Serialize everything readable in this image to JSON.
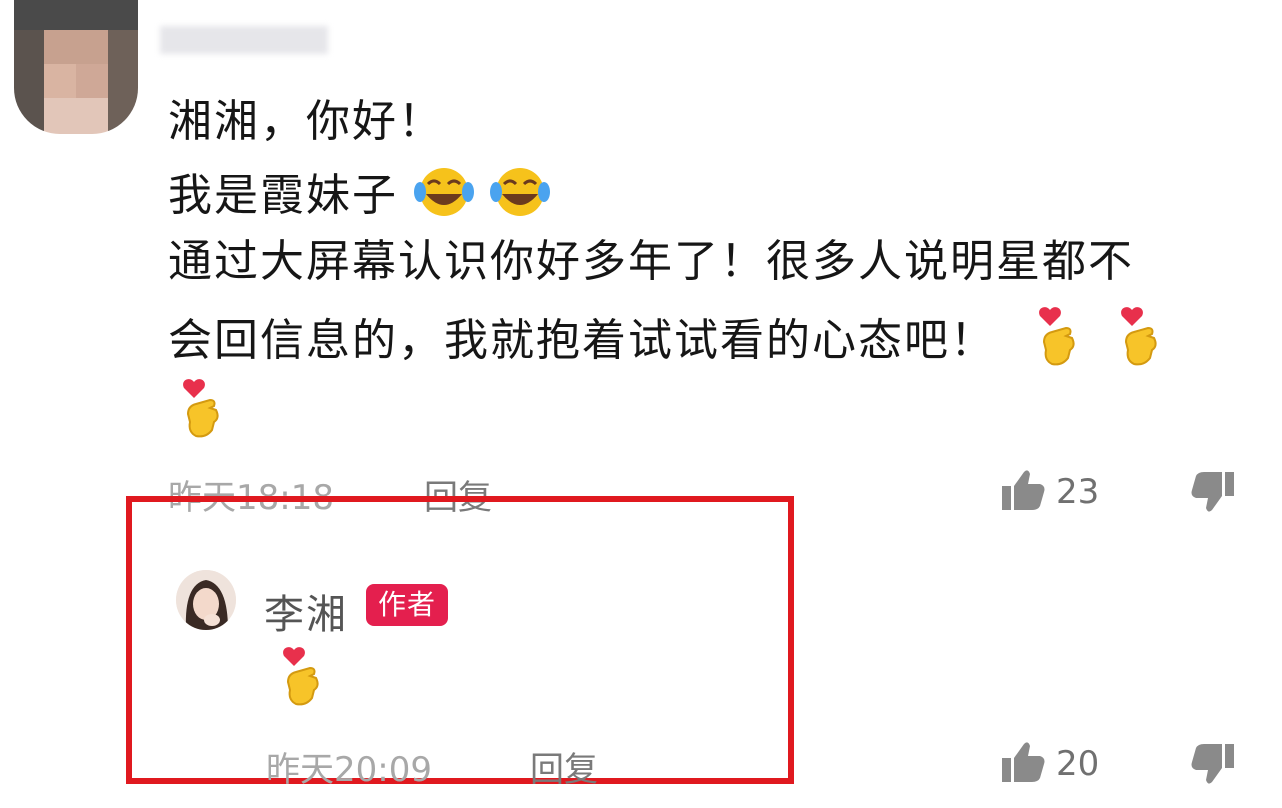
{
  "comment": {
    "lines": [
      "湘湘，你好！",
      "我是霞妹子",
      "通过大屏幕认识你好多年了！很多人说明星都不",
      "会回信息的，我就抱着试试看的心态吧！"
    ],
    "time": "昨天18:18",
    "reply_label": "回复",
    "like_count": "23"
  },
  "author_reply": {
    "name": "李湘",
    "badge": "作者",
    "time": "昨天20:09",
    "reply_label": "回复",
    "like_count": "20"
  },
  "icons": {
    "laughing": "tears-of-joy-emoji",
    "finger_heart": "finger-heart-emoji",
    "like": "thumbs-up-icon",
    "dislike": "thumbs-down-icon"
  },
  "colors": {
    "highlight": "#e0191f",
    "badge": "#e41f4e"
  }
}
